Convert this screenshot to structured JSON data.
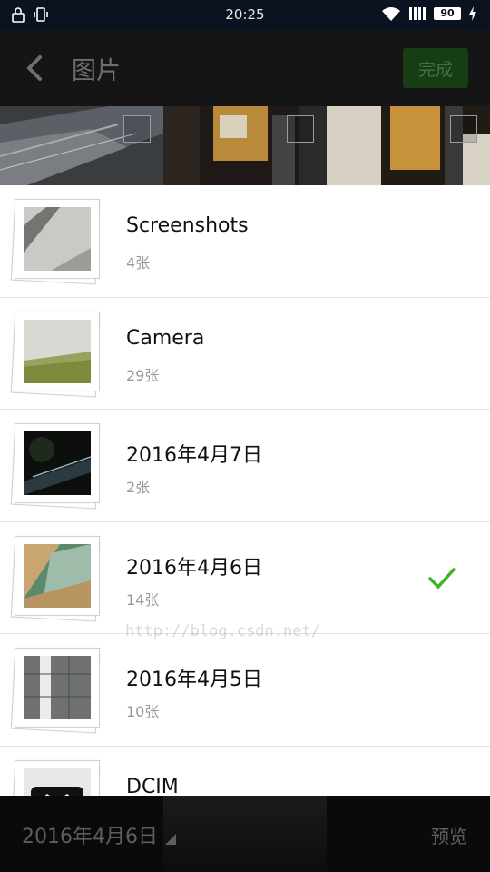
{
  "status_bar": {
    "time": "20:25",
    "battery_level": "90",
    "icons": [
      "lock-icon",
      "vibrate-icon",
      "wifi-icon",
      "signal-icon",
      "battery-icon",
      "charging-icon"
    ]
  },
  "header": {
    "title": "图片",
    "done_label": "完成",
    "back_icon": "chevron-left-icon"
  },
  "albums": [
    {
      "name": "Screenshots",
      "count": "4张",
      "selected": false
    },
    {
      "name": "Camera",
      "count": "29张",
      "selected": false
    },
    {
      "name": "2016年4月7日",
      "count": "2张",
      "selected": false
    },
    {
      "name": "2016年4月6日",
      "count": "14张",
      "selected": true
    },
    {
      "name": "2016年4月5日",
      "count": "10张",
      "selected": false
    },
    {
      "name": "DCIM",
      "count": "",
      "selected": false
    }
  ],
  "watermark": "http://blog.csdn.net/",
  "bottom_bar": {
    "current_folder": "2016年4月6日",
    "preview_label": "预览"
  },
  "colors": {
    "accent_green": "#3cb521",
    "done_button_bg": "#173d14",
    "header_bg": "#151515",
    "status_bar_bg": "#0b1220"
  }
}
